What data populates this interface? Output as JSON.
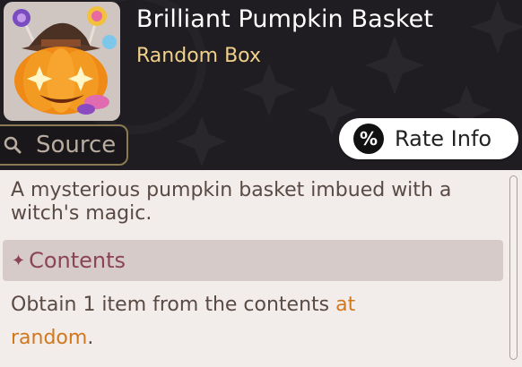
{
  "item": {
    "name": "Brilliant Pumpkin Basket",
    "type": "Random Box",
    "icon": "pumpkin-basket-icon"
  },
  "source_button": {
    "label": "Source",
    "icon": "search-icon"
  },
  "rate_info_button": {
    "label": "Rate Info",
    "icon": "percent-icon",
    "icon_glyph": "%"
  },
  "description": "A mysterious pumpkin basket imbued with a witch's magic.",
  "contents": {
    "marker": "✦",
    "heading": "Contents",
    "text_before": "Obtain 1 item from the contents ",
    "text_highlight": "at random",
    "text_after": "."
  },
  "colors": {
    "header_bg": "#1f1d21",
    "title": "#ffffff",
    "subtitle": "#f0d08a",
    "panel_bg": "#f2ecea",
    "body_text": "#5a4a44",
    "heading_text": "#8a4455",
    "highlight": "#d2781c"
  }
}
